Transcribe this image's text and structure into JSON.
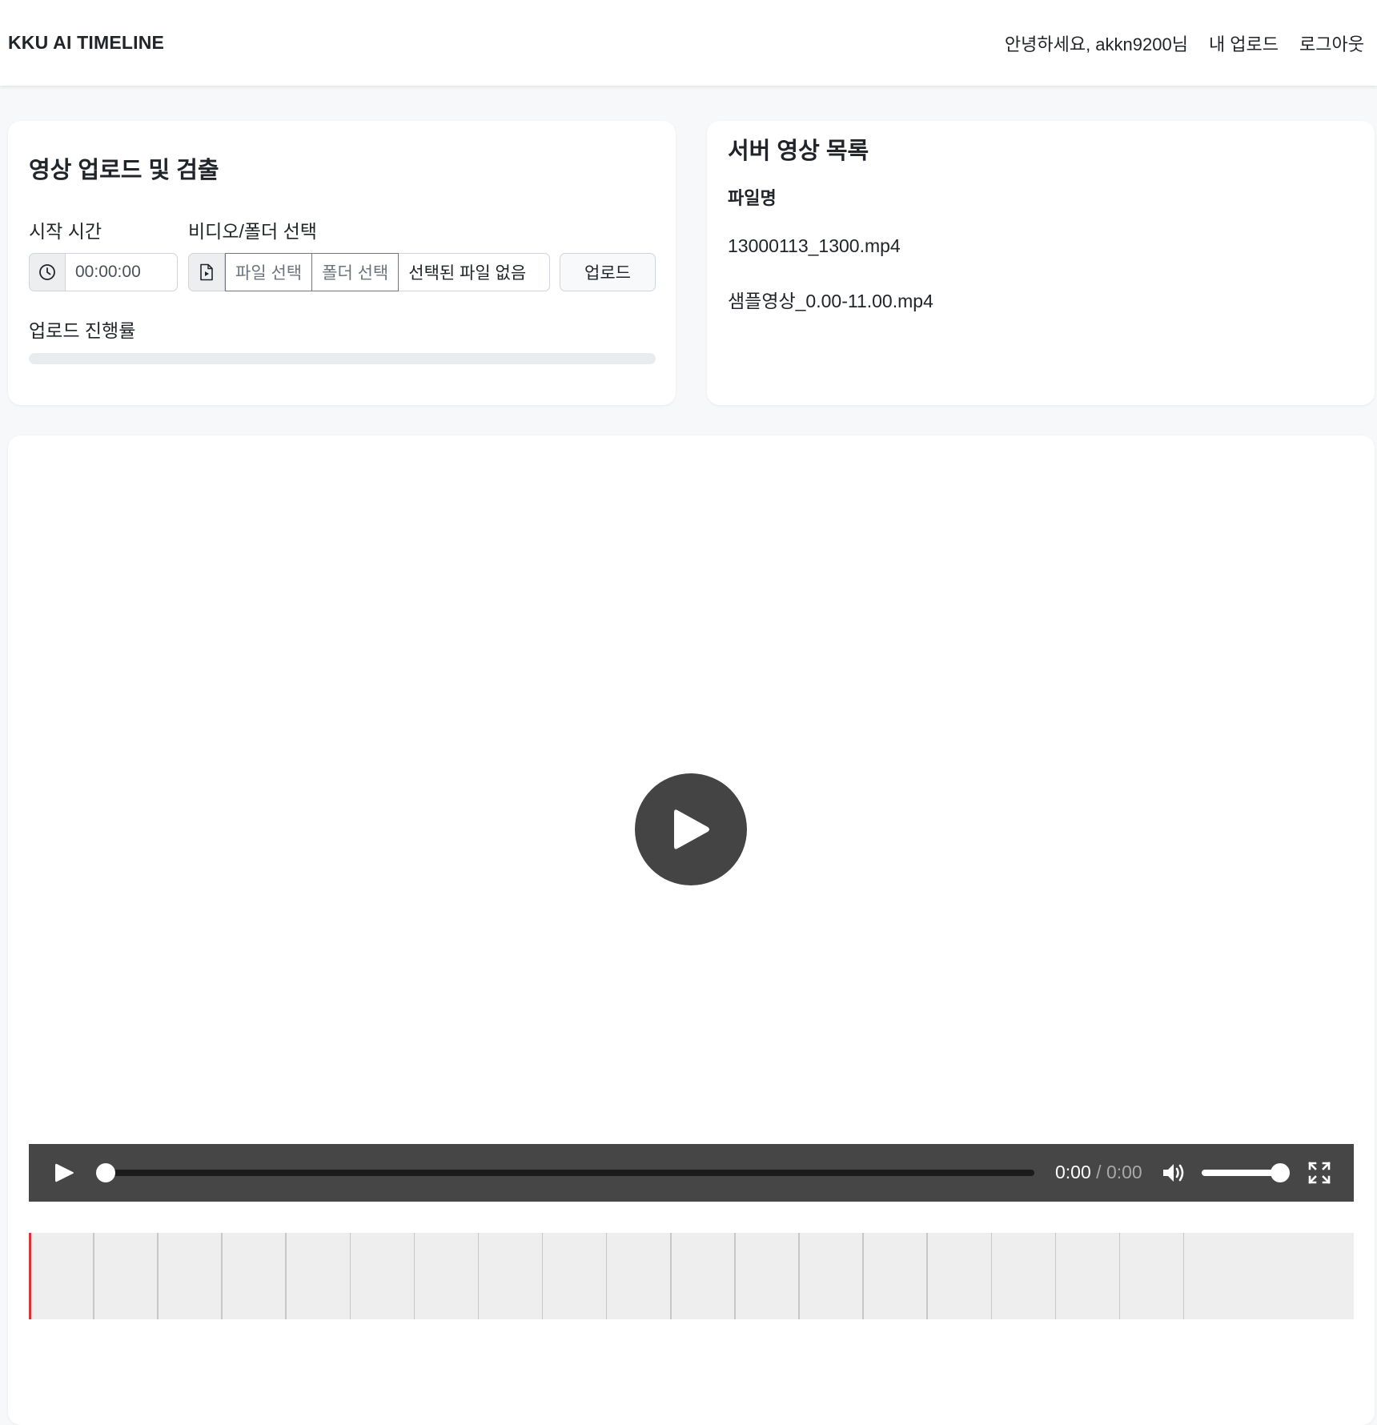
{
  "header": {
    "brand": "KKU AI TIMELINE",
    "greeting": "안녕하세요, akkn9200님",
    "my_uploads": "내 업로드",
    "logout": "로그아웃"
  },
  "upload_card": {
    "title": "영상 업로드 및 검출",
    "start_time_label": "시작 시간",
    "start_time_value": "00:00:00",
    "video_folder_label": "비디오/폴더 선택",
    "file_select_button": "파일 선택",
    "folder_select_button": "폴더 선택",
    "file_status": "선택된 파일 없음",
    "upload_button": "업로드",
    "progress_label": "업로드 진행률",
    "progress_value": 0
  },
  "server_list": {
    "title": "서버 영상 목록",
    "column_header": "파일명",
    "files": [
      "13000113_1300.mp4",
      "샘플영상_0.00-11.00.mp4"
    ]
  },
  "player": {
    "current_time": "0:00",
    "separator": " / ",
    "duration": "0:00",
    "seek_fraction": 0,
    "volume_fraction": 1,
    "timeline_segments": 19,
    "colors": {
      "controls_bg": "#464646",
      "playhead": "#d9343a",
      "timeline_bg": "#eeeeee"
    }
  }
}
